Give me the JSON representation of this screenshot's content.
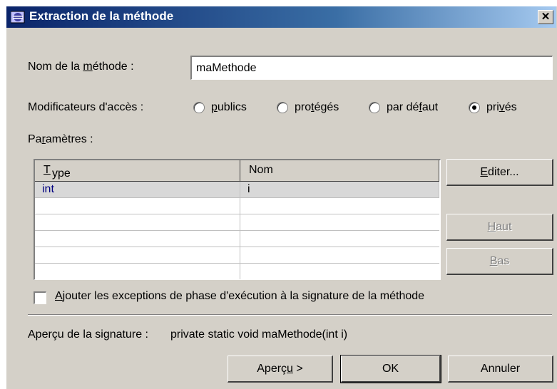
{
  "window": {
    "title": "Extraction de la méthode",
    "close_glyph": "✕"
  },
  "method_name": {
    "label_pre": "Nom de la ",
    "label_mn": "m",
    "label_post": "éthode :",
    "value": "maMethode"
  },
  "access": {
    "label": "Modificateurs d'accès :",
    "options": [
      {
        "pre": "",
        "mn": "p",
        "post": "ublics",
        "checked": false
      },
      {
        "pre": "pro",
        "mn": "t",
        "post": "égés",
        "checked": false
      },
      {
        "pre": "par dé",
        "mn": "f",
        "post": "aut",
        "checked": false
      },
      {
        "pre": "pri",
        "mn": "v",
        "post": "és",
        "checked": true
      }
    ]
  },
  "params": {
    "label_pre": "Pa",
    "label_mn": "r",
    "label_post": "amètres :",
    "columns": [
      {
        "pre": "",
        "mn": "T",
        "post": "ype"
      },
      {
        "text": "Nom"
      }
    ],
    "rows": [
      {
        "type": "int",
        "name": "i"
      }
    ]
  },
  "buttons": {
    "edit": {
      "mn": "E",
      "post": "diter..."
    },
    "up": {
      "mn": "H",
      "post": "aut"
    },
    "down": {
      "mn": "B",
      "post": "as"
    },
    "preview": {
      "pre": "Aperç",
      "mn": "u",
      "post": " >"
    },
    "ok": "OK",
    "cancel": "Annuler"
  },
  "runtime_exceptions": {
    "mn": "A",
    "post": "jouter les exceptions de phase d'exécution à la signature de la méthode",
    "checked": false
  },
  "signature": {
    "label": "Aperçu de la signature :",
    "value": "private static void maMethode(int i)"
  },
  "colors": {
    "type_text": "#000080"
  }
}
